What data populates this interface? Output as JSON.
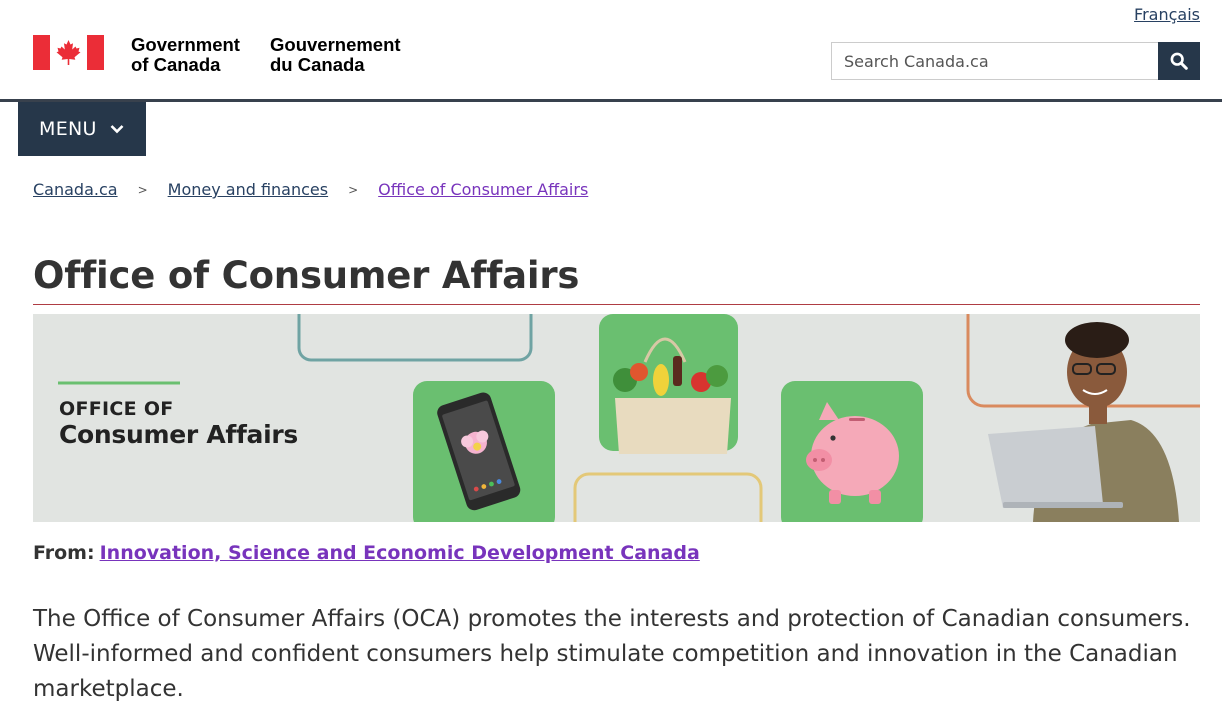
{
  "header": {
    "language_link": "Français",
    "wordmark_en": [
      "Government",
      "of Canada"
    ],
    "wordmark_fr": [
      "Gouvernement",
      "du Canada"
    ],
    "search_placeholder": "Search Canada.ca"
  },
  "menu": {
    "label": "MENU"
  },
  "breadcrumb": [
    {
      "label": "Canada.ca"
    },
    {
      "label": "Money and finances"
    },
    {
      "label": "Office of Consumer Affairs"
    }
  ],
  "page_title": "Office of Consumer Affairs",
  "banner": {
    "line1": "OFFICE OF",
    "line2": "Consumer Affairs"
  },
  "from": {
    "label": "From:",
    "link": "Innovation, Science and Economic Development Canada"
  },
  "intro": "The Office of Consumer Affairs (OCA) promotes the interests and protection of Canadian consumers. Well-informed and confident consumers help stimulate competition and innovation in the Canadian marketplace.",
  "colors": {
    "brand_red": "#eb2d37",
    "nav_dark": "#26374a",
    "link": "#284162",
    "visited_link": "#7834bc",
    "title_rule": "#af3c43",
    "banner_green": "#6abf70"
  }
}
